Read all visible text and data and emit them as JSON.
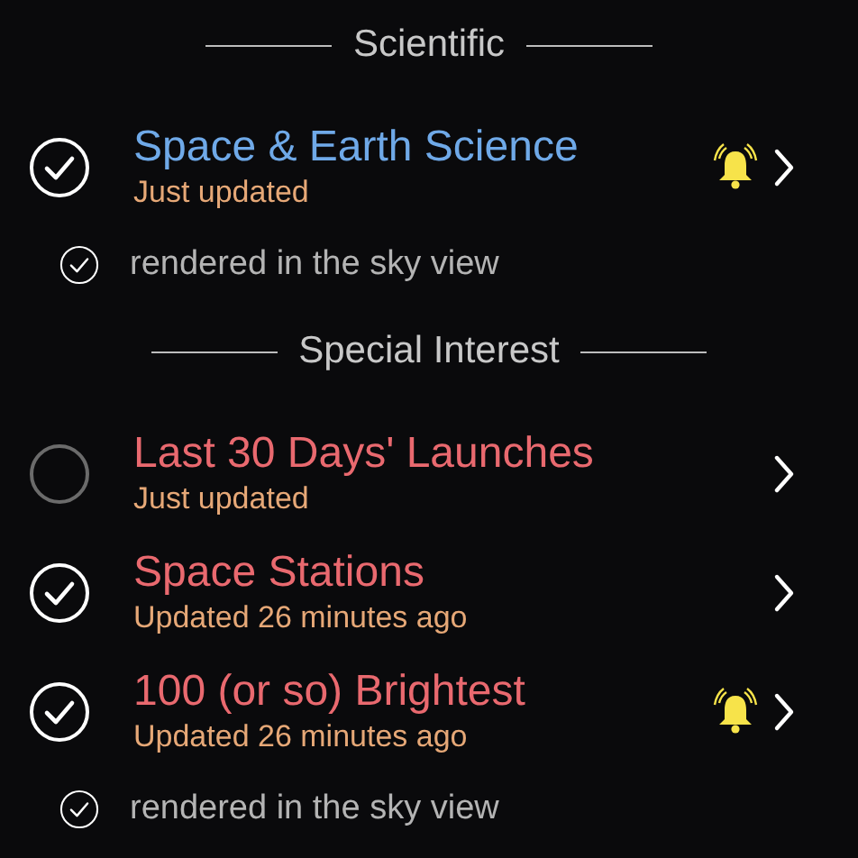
{
  "sections": [
    {
      "title": "Scientific",
      "items": [
        {
          "title": "Space & Earth Science",
          "color": "#6fa9e8",
          "subtitle": "Just updated",
          "checked": true,
          "alert": true,
          "sky_view": {
            "label": "rendered in the sky view",
            "checked": true
          }
        }
      ]
    },
    {
      "title": "Special Interest",
      "items": [
        {
          "title": "Last 30 Days' Launches",
          "color": "#e9696f",
          "subtitle": "Just updated",
          "checked": false,
          "alert": false
        },
        {
          "title": "Space Stations",
          "color": "#e9696f",
          "subtitle": "Updated 26 minutes ago",
          "checked": true,
          "alert": false
        },
        {
          "title": "100 (or so) Brightest",
          "color": "#e9696f",
          "subtitle": "Updated 26 minutes ago",
          "checked": true,
          "alert": true,
          "sky_view": {
            "label": "rendered in the sky view",
            "checked": true
          }
        }
      ]
    }
  ]
}
